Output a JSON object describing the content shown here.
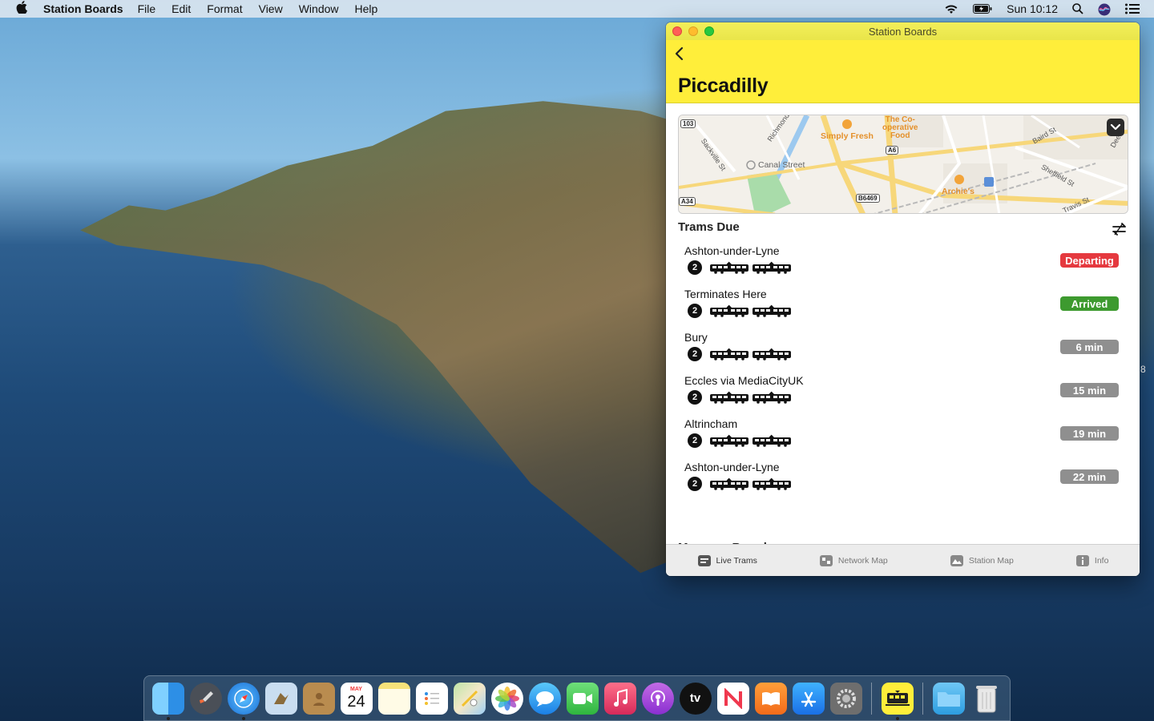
{
  "menubar": {
    "app_name": "Station Boards",
    "menus": [
      "File",
      "Edit",
      "Format",
      "View",
      "Window",
      "Help"
    ],
    "clock": "Sun 10:12"
  },
  "window": {
    "title": "Station Boards",
    "station_name": "Piccadilly",
    "section_title": "Trams Due",
    "next_section_title": "Message Board"
  },
  "map": {
    "labels": {
      "road_103": "103",
      "richmond": "Richmond",
      "sackville": "Sackville St",
      "canal_street": "Canal Street",
      "simply_fresh": "Simply Fresh",
      "coop": "The Co-\noperative\nFood",
      "a6": "A6",
      "baird": "Baird St",
      "sheffield": "Sheffield St",
      "archies": "Archie's",
      "b6469": "B6469",
      "a34": "A34",
      "travis": "Travis St",
      "deer": "Deer"
    }
  },
  "trams": [
    {
      "destination": "Ashton-under-Lyne",
      "cars": "2",
      "status": "Departing",
      "status_color": "#e5393f"
    },
    {
      "destination": "Terminates Here",
      "cars": "2",
      "status": "Arrived",
      "status_color": "#3d9a2f"
    },
    {
      "destination": "Bury",
      "cars": "2",
      "status": "6 min",
      "status_color": "#8f8f8f"
    },
    {
      "destination": "Eccles via MediaCityUK",
      "cars": "2",
      "status": "15 min",
      "status_color": "#8f8f8f"
    },
    {
      "destination": "Altrincham",
      "cars": "2",
      "status": "19 min",
      "status_color": "#8f8f8f"
    },
    {
      "destination": "Ashton-under-Lyne",
      "cars": "2",
      "status": "22 min",
      "status_color": "#8f8f8f"
    }
  ],
  "tabs": [
    {
      "label": "Live Trams",
      "icon": "list-icon",
      "active": true
    },
    {
      "label": "Network Map",
      "icon": "network-map-icon",
      "active": false
    },
    {
      "label": "Station Map",
      "icon": "station-map-icon",
      "active": false
    },
    {
      "label": "Info",
      "icon": "info-icon",
      "active": false
    }
  ],
  "dock": {
    "calendar_month": "MAY",
    "calendar_day": "24",
    "tv_label": "tv"
  },
  "side_glyph": "8"
}
